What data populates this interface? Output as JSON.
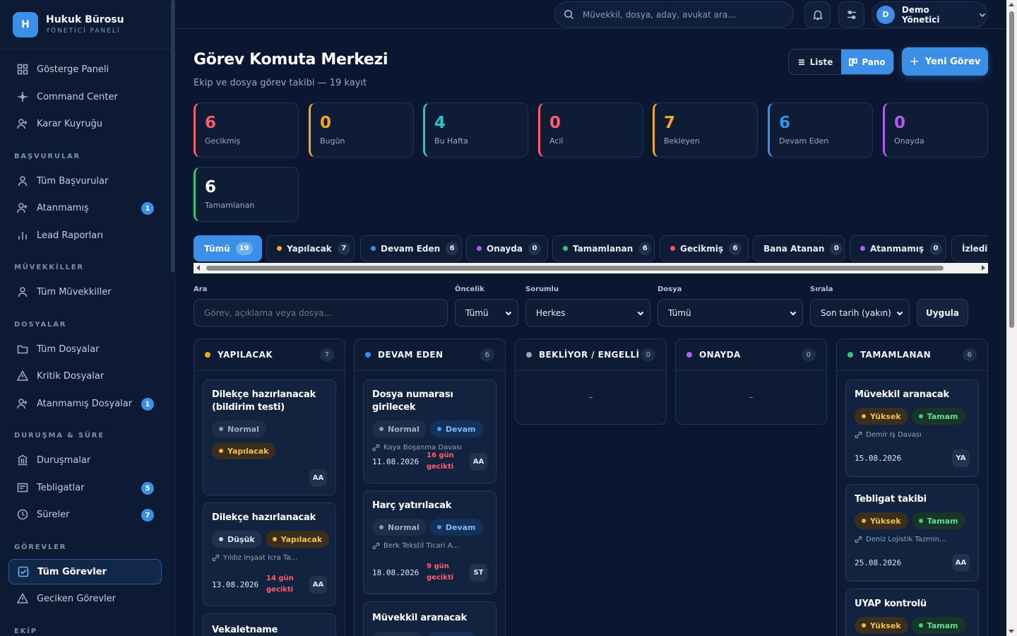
{
  "brand": {
    "initial": "H",
    "name": "Hukuk Bürosu",
    "subtitle": "YÖNETİCİ PANELİ"
  },
  "sidebar": {
    "items": [
      {
        "label": "Gösterge Paneli",
        "icon": "grid-icon"
      },
      {
        "label": "Command Center",
        "icon": "crosshair-icon"
      },
      {
        "label": "Karar Kuyruğu",
        "icon": "user-plus-icon"
      },
      {
        "label": "Tüm Başvurular",
        "icon": "user-icon"
      },
      {
        "label": "Atanmamış",
        "icon": "user-plus-icon",
        "badge": "1"
      },
      {
        "label": "Lead Raporları",
        "icon": "bar-chart-icon"
      },
      {
        "label": "Tüm Müvekkiller",
        "icon": "user-icon"
      },
      {
        "label": "Tüm Dosyalar",
        "icon": "folder-icon"
      },
      {
        "label": "Kritik Dosyalar",
        "icon": "warning-icon"
      },
      {
        "label": "Atanmamış Dosyalar",
        "icon": "user-plus-icon",
        "badge": "1"
      },
      {
        "label": "Duruşmalar",
        "icon": "courthouse-icon"
      },
      {
        "label": "Tebligatlar",
        "icon": "inbox-icon",
        "badge": "5"
      },
      {
        "label": "Süreler",
        "icon": "clock-icon",
        "badge": "7"
      },
      {
        "label": "Tüm Görevler",
        "icon": "checkbox-icon",
        "active": true
      },
      {
        "label": "Geciken Görevler",
        "icon": "warning-icon"
      }
    ],
    "sections": [
      "BAŞVURULAR",
      "MÜVEKKİLLER",
      "DOSYALAR",
      "DURUŞMA & SÜRE",
      "GÖREVLER",
      "EKİP"
    ]
  },
  "topbar": {
    "search_placeholder": "Müvekkil, dosya, aday, avukat ara...",
    "user_initial": "D",
    "user_name": "Demo Yönetici"
  },
  "header": {
    "title": "Görev Komuta Merkezi",
    "subtitle": "Ekip ve dosya görev takibi — 19 kayıt",
    "view_list": "Liste",
    "view_board": "Pano",
    "new_task": "Yeni Görev"
  },
  "stats": [
    {
      "value": "6",
      "label": "Gecikmiş",
      "color": "#ff5c6c"
    },
    {
      "value": "0",
      "label": "Bugün",
      "color": "#f5a623"
    },
    {
      "value": "4",
      "label": "Bu Hafta",
      "color": "#2ec4c4"
    },
    {
      "value": "0",
      "label": "Acil",
      "color": "#ff5c6c"
    },
    {
      "value": "7",
      "label": "Bekleyen",
      "color": "#f5a623"
    },
    {
      "value": "6",
      "label": "Devam Eden",
      "color": "#3b8fe6"
    },
    {
      "value": "0",
      "label": "Onayda",
      "color": "#b05cf0"
    },
    {
      "value": "6",
      "label": "Tamamlanan",
      "color": "#34c77b"
    }
  ],
  "tabs": [
    {
      "label": "Tümü",
      "count": "19"
    },
    {
      "label": "Yapılacak",
      "count": "7",
      "dot": "#f5a623"
    },
    {
      "label": "Devam Eden",
      "count": "6",
      "dot": "#3b8fe6"
    },
    {
      "label": "Onayda",
      "count": "0",
      "dot": "#b05cf0"
    },
    {
      "label": "Tamamlanan",
      "count": "6",
      "dot": "#34c77b"
    },
    {
      "label": "Gecikmiş",
      "count": "6",
      "dot": "#ff4d5e"
    },
    {
      "label": "Bana Atanan",
      "count": "0"
    },
    {
      "label": "Atanmamış",
      "count": "0",
      "dot": "#b05cf0"
    },
    {
      "label": "İzledi"
    }
  ],
  "filters": {
    "search_label": "Ara",
    "search_placeholder": "Görev, açıklama veya dosya...",
    "priority_label": "Öncelik",
    "priority_value": "Tümü",
    "owner_label": "Sorumlu",
    "owner_value": "Herkes",
    "file_label": "Dosya",
    "file_value": "Tümü",
    "sort_label": "Sırala",
    "sort_value": "Son tarih (yakın)",
    "apply": "Uygula"
  },
  "columns": [
    {
      "title": "YAPILACAK",
      "count": "7",
      "color": "#f5a623"
    },
    {
      "title": "DEVAM EDEN",
      "count": "6",
      "color": "#3b8fe6"
    },
    {
      "title": "BEKLİYOR / ENGELLİ",
      "count": "0",
      "color": "#9aa4b8",
      "empty": "–"
    },
    {
      "title": "ONAYDA",
      "count": "0",
      "color": "#b05cf0",
      "empty": "–"
    },
    {
      "title": "TAMAMLANAN",
      "count": "6",
      "color": "#34c77b"
    }
  ],
  "cards": {
    "todo": [
      {
        "title": "Dilekçe hazırlanacak (bildirim testi)",
        "priority": "Normal",
        "status": "Yapılacak",
        "initials": "AA"
      },
      {
        "title": "Dilekçe hazırlanacak",
        "priority": "Düşük",
        "status": "Yapılacak",
        "file": "Yıldız İnşaat İcra Ta...",
        "date": "13.08.2026",
        "late": "14 gün gecikti",
        "initials": "AA"
      },
      {
        "title": "Vekaletname taranacak"
      }
    ],
    "progress": [
      {
        "title": "Dosya numarası girilecek",
        "priority": "Normal",
        "status": "Devam",
        "file": "Kaya Boşanma Davası",
        "date": "11.08.2026",
        "late": "16 gün gecikti",
        "initials": "AA"
      },
      {
        "title": "Harç yatırılacak",
        "priority": "Normal",
        "status": "Devam",
        "file": "Berk Tekstil Ticari A...",
        "date": "18.08.2026",
        "late": "9 gün gecikti",
        "initials": "ST"
      },
      {
        "title": "Müvekkil aranacak"
      }
    ],
    "done": [
      {
        "title": "Müvekkil aranacak",
        "priority": "Yüksek",
        "status": "Tamam",
        "file": "Demir İş Davası",
        "date": "15.08.2026",
        "initials": "YA"
      },
      {
        "title": "Tebligat takibi",
        "priority": "Yüksek",
        "status": "Tamam",
        "file": "Deniz Lojistik Tazmin...",
        "date": "25.08.2026",
        "initials": "AA"
      },
      {
        "title": "UYAP kontrolü",
        "priority": "Yüksek",
        "status": "Tamam"
      }
    ]
  }
}
